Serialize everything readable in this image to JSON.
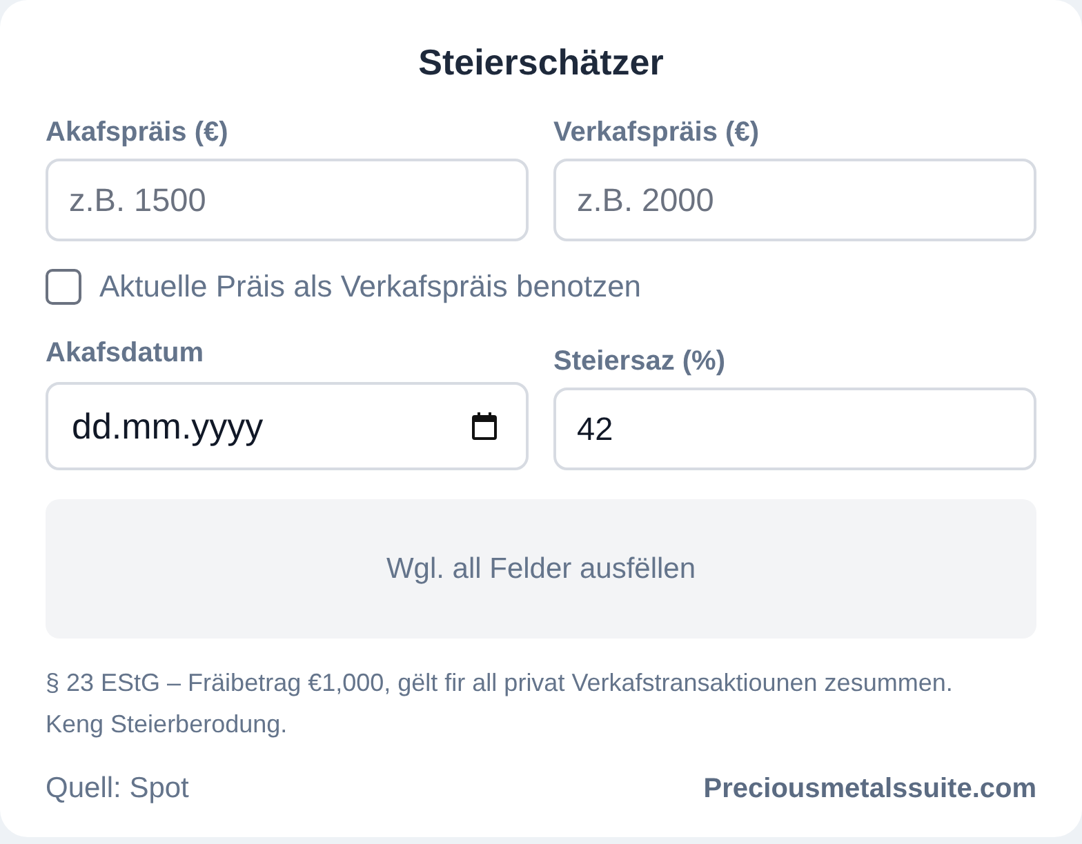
{
  "title": "Steierschätzer",
  "fields_row_1": [
    {
      "label": "Akafspräis (€)",
      "kind": "number",
      "placeholder": "z.B. 1500"
    },
    {
      "label": "Verkafspräis (€)",
      "kind": "number",
      "placeholder": "z.B. 2000"
    }
  ],
  "checkbox": {
    "label": "Aktuelle Präis als Verkafspräis benotzen",
    "checked": false
  },
  "fields_row_2": [
    {
      "label": "Akafsdatum",
      "kind": "date",
      "placeholder": "dd.mm.yyyy"
    },
    {
      "label": "Steiersaz (%)",
      "kind": "number",
      "value": "42"
    }
  ],
  "result": {
    "text": "Wgl. all Felder ausfëllen"
  },
  "note": "§ 23 EStG – Fräibetrag €1,000, gëlt fir all privat Verkafstransaktiounen zesummen. Keng Steierberodung.",
  "footer": {
    "source": "Quell: Spot",
    "brand": "Preciousmetalssuite.com"
  }
}
